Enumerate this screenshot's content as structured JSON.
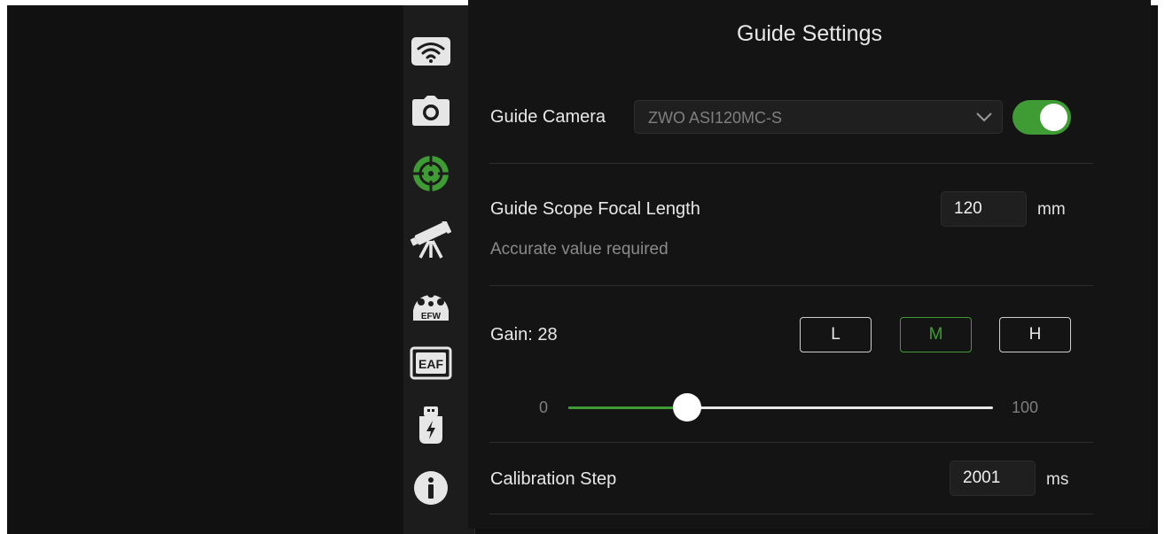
{
  "page": {
    "title": "Guide Settings"
  },
  "sidebar": {
    "icons": [
      "wifi-icon",
      "camera-icon",
      "guide-crosshair-icon",
      "telescope-icon",
      "efw-icon",
      "eaf-icon",
      "usb-drive-icon",
      "info-icon"
    ],
    "efw_label": "EFW",
    "eaf_label": "EAF",
    "active_color": "#3f9b33"
  },
  "guide_camera": {
    "label": "Guide Camera",
    "selected": "ZWO ASI120MC-S",
    "enabled": true
  },
  "focal_length": {
    "label": "Guide Scope Focal Length",
    "value": "120",
    "unit": "mm",
    "hint": "Accurate value required"
  },
  "gain": {
    "label": "Gain: 28",
    "presets": [
      "L",
      "M",
      "H"
    ],
    "active_preset": "M",
    "min_label": "0",
    "max_label": "100",
    "value": 28,
    "min": 0,
    "max": 100
  },
  "calibration": {
    "label": "Calibration Step",
    "value": "2001",
    "unit": "ms"
  },
  "colors": {
    "accent": "#3f9b33",
    "background": "#141414",
    "rail": "#1c1c1c"
  }
}
